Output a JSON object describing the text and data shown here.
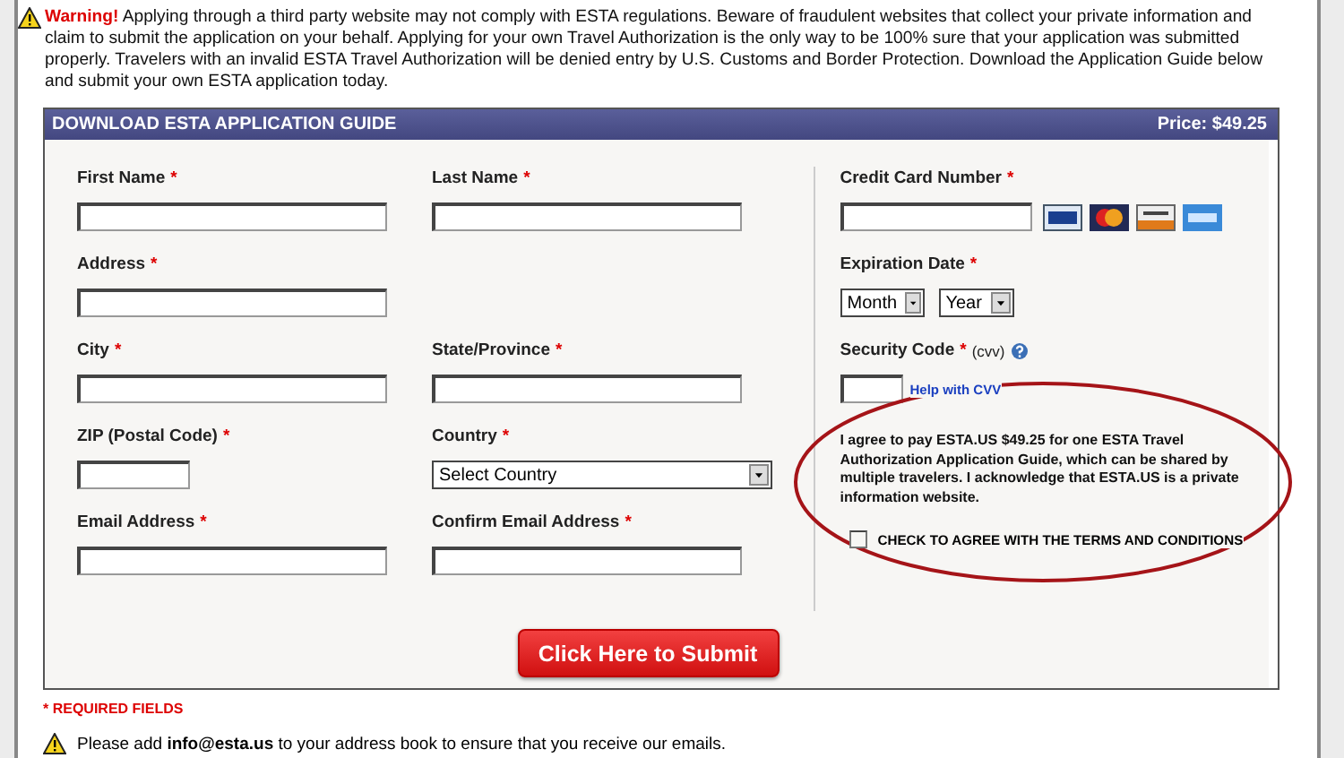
{
  "warning": {
    "label": "Warning!",
    "text": "Applying through a third party website may not comply with ESTA regulations. Beware of fraudulent websites that collect your private information and claim to submit the application on your behalf. Applying for your own Travel Authorization is the only way to be 100% sure that your application was submitted properly. Travelers with an invalid ESTA Travel Authorization will be denied entry by U.S. Customs and Border Protection. Download the Application Guide below and submit your own ESTA application today."
  },
  "panel": {
    "title": "DOWNLOAD ESTA APPLICATION GUIDE",
    "price": "Price: $49.25"
  },
  "rows": [
    [
      {
        "label": "First Name",
        "mark": "*",
        "kind": "text"
      },
      {
        "label": "Last Name",
        "mark": "*",
        "kind": "text"
      }
    ],
    [
      {
        "label": "Address",
        "mark": "*",
        "kind": "text"
      }
    ],
    [
      {
        "label": "City",
        "mark": "*",
        "kind": "text"
      },
      {
        "label": "State/Province",
        "mark": "*",
        "kind": "text"
      }
    ],
    [
      {
        "label": "ZIP (Postal Code)",
        "mark": "*",
        "kind": "short"
      },
      {
        "label": "Country",
        "mark": "*",
        "kind": "select",
        "value": "Select Country"
      }
    ],
    [
      {
        "label": "Email Address",
        "mark": "*",
        "kind": "text"
      },
      {
        "label": "Confirm Email Address",
        "mark": "*",
        "kind": "text"
      }
    ]
  ],
  "payment": {
    "card": {
      "label": "Credit Card Number",
      "mark": "*"
    },
    "expiration": {
      "label": "Expiration Date",
      "mark": "*",
      "selects": [
        "Month",
        "Year"
      ]
    },
    "security": {
      "label": "Security Code",
      "mark": "*",
      "hint": "(cvv)",
      "help_link": "Help with CVV"
    },
    "agreement": "I agree to pay ESTA.US $49.25 for one ESTA Travel Authorization Application Guide, which can be shared by multiple travelers. I acknowledge that ESTA.US is a private information website.",
    "terms": {
      "label": "CHECK TO AGREE WITH THE TERMS AND CONDITIONS",
      "checked": false
    }
  },
  "submit": "Click Here to Submit",
  "required_note": "* REQUIRED FIELDS",
  "email_note": "Please add **info@esta.us** to your address book to ensure that you receive our emails."
}
